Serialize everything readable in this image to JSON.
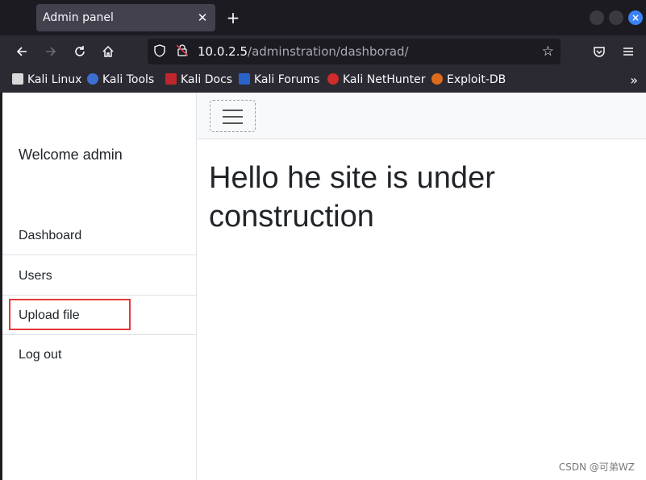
{
  "browser": {
    "tab_title": "Admin panel",
    "tab_close": "✕",
    "new_tab": "+",
    "url_host": "10.0.2.5",
    "url_path": "/adminstration/dashborad/",
    "bookmarks": [
      {
        "label": "Kali Linux",
        "color": "#1f1f1f"
      },
      {
        "label": "Kali Tools",
        "color": "#3b6fd1"
      },
      {
        "label": "Kali Docs",
        "color": "#c0262d"
      },
      {
        "label": "Kali Forums",
        "color": "#2a63c9"
      },
      {
        "label": "Kali NetHunter",
        "color": "#d12b2b"
      },
      {
        "label": "Exploit-DB",
        "color": "#e06a1b"
      }
    ],
    "more": "»"
  },
  "sidebar": {
    "welcome": "Welcome admin",
    "items": [
      {
        "label": "Dashboard"
      },
      {
        "label": "Users"
      },
      {
        "label": "Upload file"
      },
      {
        "label": "Log out"
      }
    ]
  },
  "main": {
    "heading": "Hello he site is under construction"
  },
  "watermark": "CSDN @可弟WZ",
  "colors": {
    "highlight": "#e5373b",
    "accent": "#3b82f6"
  }
}
